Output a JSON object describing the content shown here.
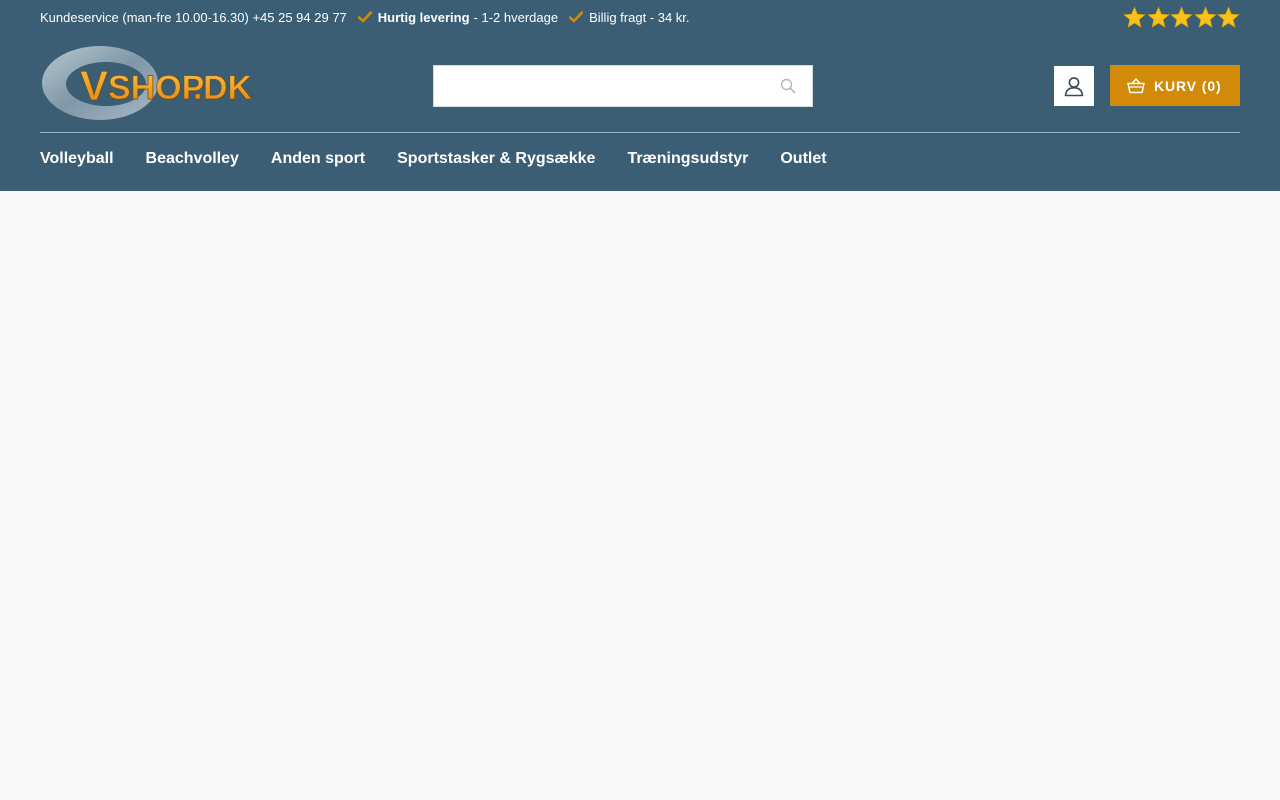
{
  "topbar": {
    "customer_service": "Kundeservice (man-fre 10.00-16.30) +45 25 94 29 77",
    "usp_fast_bold": "Hurtig levering",
    "usp_fast_rest": "- 1-2 hverdage",
    "usp_shipping": "Billig fragt - 34 kr.",
    "rating_stars": 5
  },
  "logo": {
    "text_v": "V",
    "text_shop": "SHOP",
    "text_dot": ".",
    "text_dk": "DK"
  },
  "search": {
    "placeholder": "",
    "value": ""
  },
  "cart": {
    "label": "KURV (0)"
  },
  "nav": {
    "items": [
      {
        "label": "Volleyball"
      },
      {
        "label": "Beachvolley"
      },
      {
        "label": "Anden sport"
      },
      {
        "label": "Sportstasker & Rygsække"
      },
      {
        "label": "Træningsudstyr"
      },
      {
        "label": "Outlet"
      }
    ]
  },
  "colors": {
    "header_bg": "#3b5e75",
    "accent": "#d18b08",
    "star": "#f6c21b",
    "page_bg": "#f9f9f9"
  },
  "icons": {
    "check": "check-icon",
    "star": "star-icon",
    "search": "search-icon",
    "account": "user-icon",
    "cart": "basket-icon"
  }
}
